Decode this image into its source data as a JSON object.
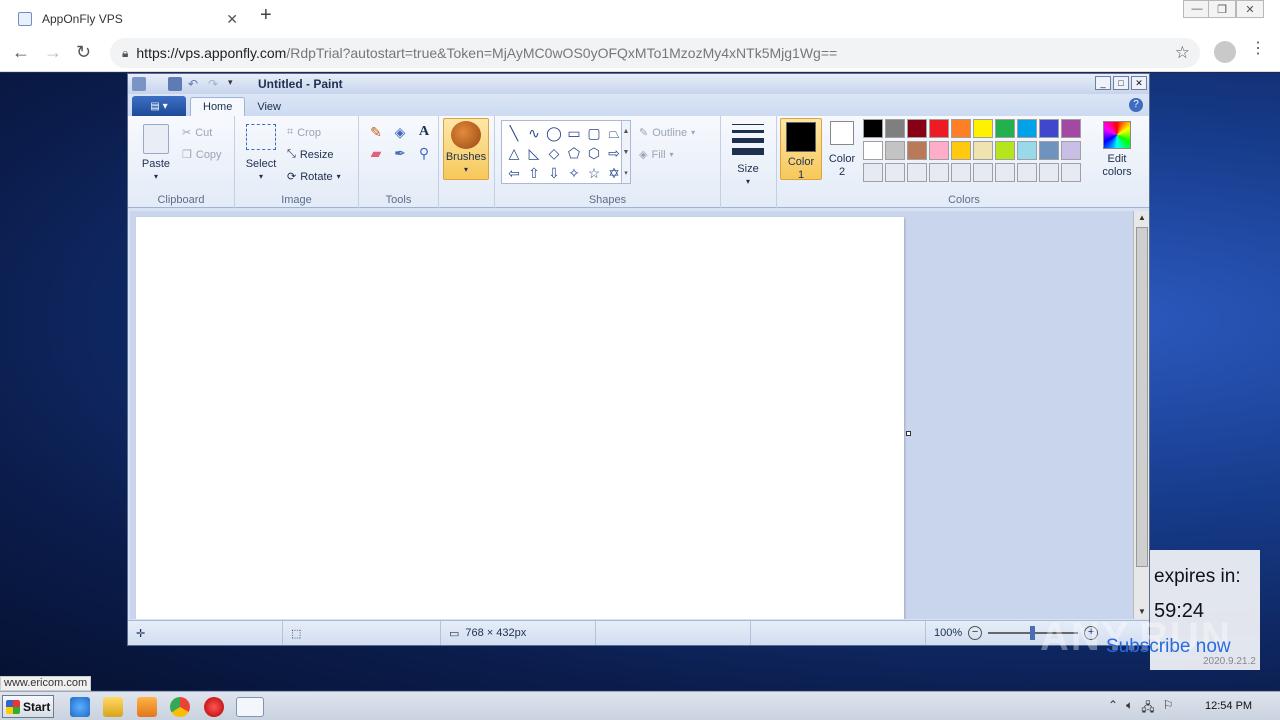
{
  "browser": {
    "tab_title": "AppOnFly VPS",
    "tab_close": "✕",
    "new_tab": "+",
    "url_host": "https://vps.apponfly.com",
    "url_path": "/RdpTrial?autostart=true&Token=MjAyMC0wOS0yOFQxMTo1MzozMy4xNTk5Mjg1Wg==",
    "status_link": "www.ericom.com"
  },
  "paint": {
    "window_title": "Untitled - Paint",
    "tabs": [
      {
        "label": "Home"
      },
      {
        "label": "View"
      }
    ],
    "groups": {
      "clipboard": {
        "label": "Clipboard",
        "paste": "Paste",
        "cut": "Cut",
        "copy": "Copy"
      },
      "image": {
        "label": "Image",
        "select": "Select",
        "crop": "Crop",
        "resize": "Resize",
        "rotate": "Rotate"
      },
      "tools": {
        "label": "Tools"
      },
      "brushes": {
        "label": "Brushes"
      },
      "shapes": {
        "label": "Shapes",
        "outline": "Outline",
        "fill": "Fill"
      },
      "size": {
        "label": "Size"
      },
      "colors": {
        "label": "Colors",
        "color1": "Color 1",
        "color2": "Color 2",
        "edit": "Edit colors"
      }
    },
    "palette_row1": [
      "#000000",
      "#7f7f7f",
      "#880015",
      "#ed1c24",
      "#ff7f27",
      "#fff200",
      "#22b14c",
      "#00a2e8",
      "#3f48cc",
      "#a349a4"
    ],
    "palette_row2": [
      "#ffffff",
      "#c3c3c3",
      "#b97a57",
      "#ffaec9",
      "#ffc90e",
      "#efe4b0",
      "#b5e61d",
      "#99d9ea",
      "#7092be",
      "#c8bfe7"
    ],
    "color1": "#000000",
    "color2": "#ffffff",
    "status": {
      "dimensions": "768 × 432px",
      "zoom": "100%"
    }
  },
  "overlay": {
    "expires_label": "expires in:",
    "expires_time": "59:24",
    "subscribe": "Subscribe now",
    "version": "2020.9.21.2",
    "watermark": "ANY.RUN"
  },
  "taskbar": {
    "start": "Start",
    "clock": "12:54 PM"
  }
}
